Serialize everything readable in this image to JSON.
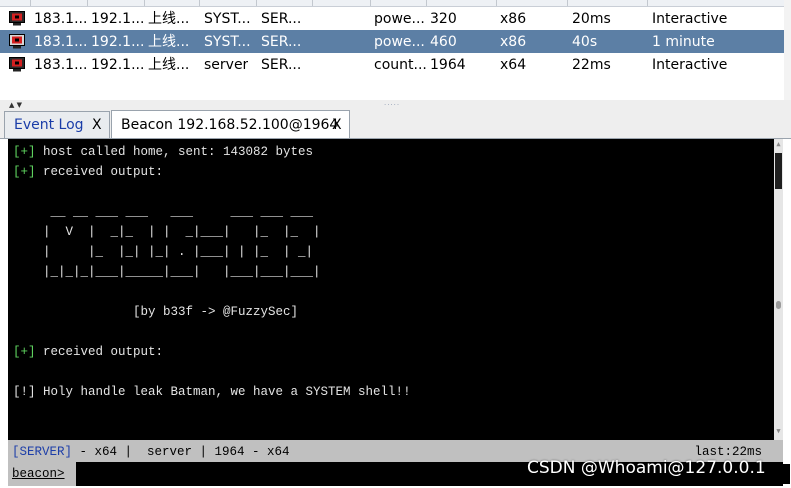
{
  "sessions": [
    {
      "external": "183.1...",
      "internal": "192.1...",
      "listener": "上线...",
      "user": "SYST...",
      "computer": "SER...",
      "process": "powe...",
      "pid": "320",
      "arch": "x86",
      "last": "20ms",
      "note": "Interactive",
      "selected": false
    },
    {
      "external": "183.1...",
      "internal": "192.1...",
      "listener": "上线...",
      "user": "SYST...",
      "computer": "SER...",
      "process": "powe...",
      "pid": "460",
      "arch": "x86",
      "last": "40s",
      "note": " 1 minute",
      "selected": true
    },
    {
      "external": "183.1...",
      "internal": "192.1...",
      "listener": "上线...",
      "user": "server",
      "computer": "SER...",
      "process": "count...",
      "pid": "1964",
      "arch": "x64",
      "last": "22ms",
      "note": "Interactive",
      "selected": false
    }
  ],
  "tabs": [
    {
      "label": "Event Log",
      "close": "X"
    },
    {
      "label": "Beacon 192.168.52.100@1964",
      "close": "X"
    }
  ],
  "console": {
    "lines": [
      {
        "prefix": "[+]",
        "text": " host called home, sent: 143082 bytes"
      },
      {
        "prefix": "[+]",
        "text": " received output:"
      },
      {
        "prefix": "",
        "text": ""
      },
      {
        "prefix": "",
        "text": "     __ __ ___ ___   ___     ___ ___ ___"
      },
      {
        "prefix": "",
        "text": "    |  V  |  _|_  | |  _|___|   |_  |_  |"
      },
      {
        "prefix": "",
        "text": "    |     |_  |_| |_| . |___| | |_  | _|"
      },
      {
        "prefix": "",
        "text": "    |_|_|_|___|_____|___|   |___|___|___|"
      },
      {
        "prefix": "",
        "text": ""
      },
      {
        "prefix": "",
        "text": "                [by b33f -> @FuzzySec]"
      },
      {
        "prefix": "",
        "text": ""
      },
      {
        "prefix": "[+]",
        "text": " received output:"
      },
      {
        "prefix": "",
        "text": ""
      },
      {
        "prefix": "",
        "text": "[!] Holy handle leak Batman, we have a SYSTEM shell!!"
      }
    ]
  },
  "status": {
    "server_tag": "[SERVER]",
    "rest": " - x64 |  server | 1964 - x64",
    "last": "last:22ms"
  },
  "input": {
    "prompt": "beacon>",
    "value": ""
  },
  "watermark": "CSDN @Whoami@127.0.0.1",
  "colors": {
    "selected_row": "#5c7fa5",
    "console_bg": "#000000",
    "plus": "#5fd35f",
    "status_bg": "#c0c0c0"
  },
  "icons": {
    "session": "computer-monitor-icon"
  }
}
